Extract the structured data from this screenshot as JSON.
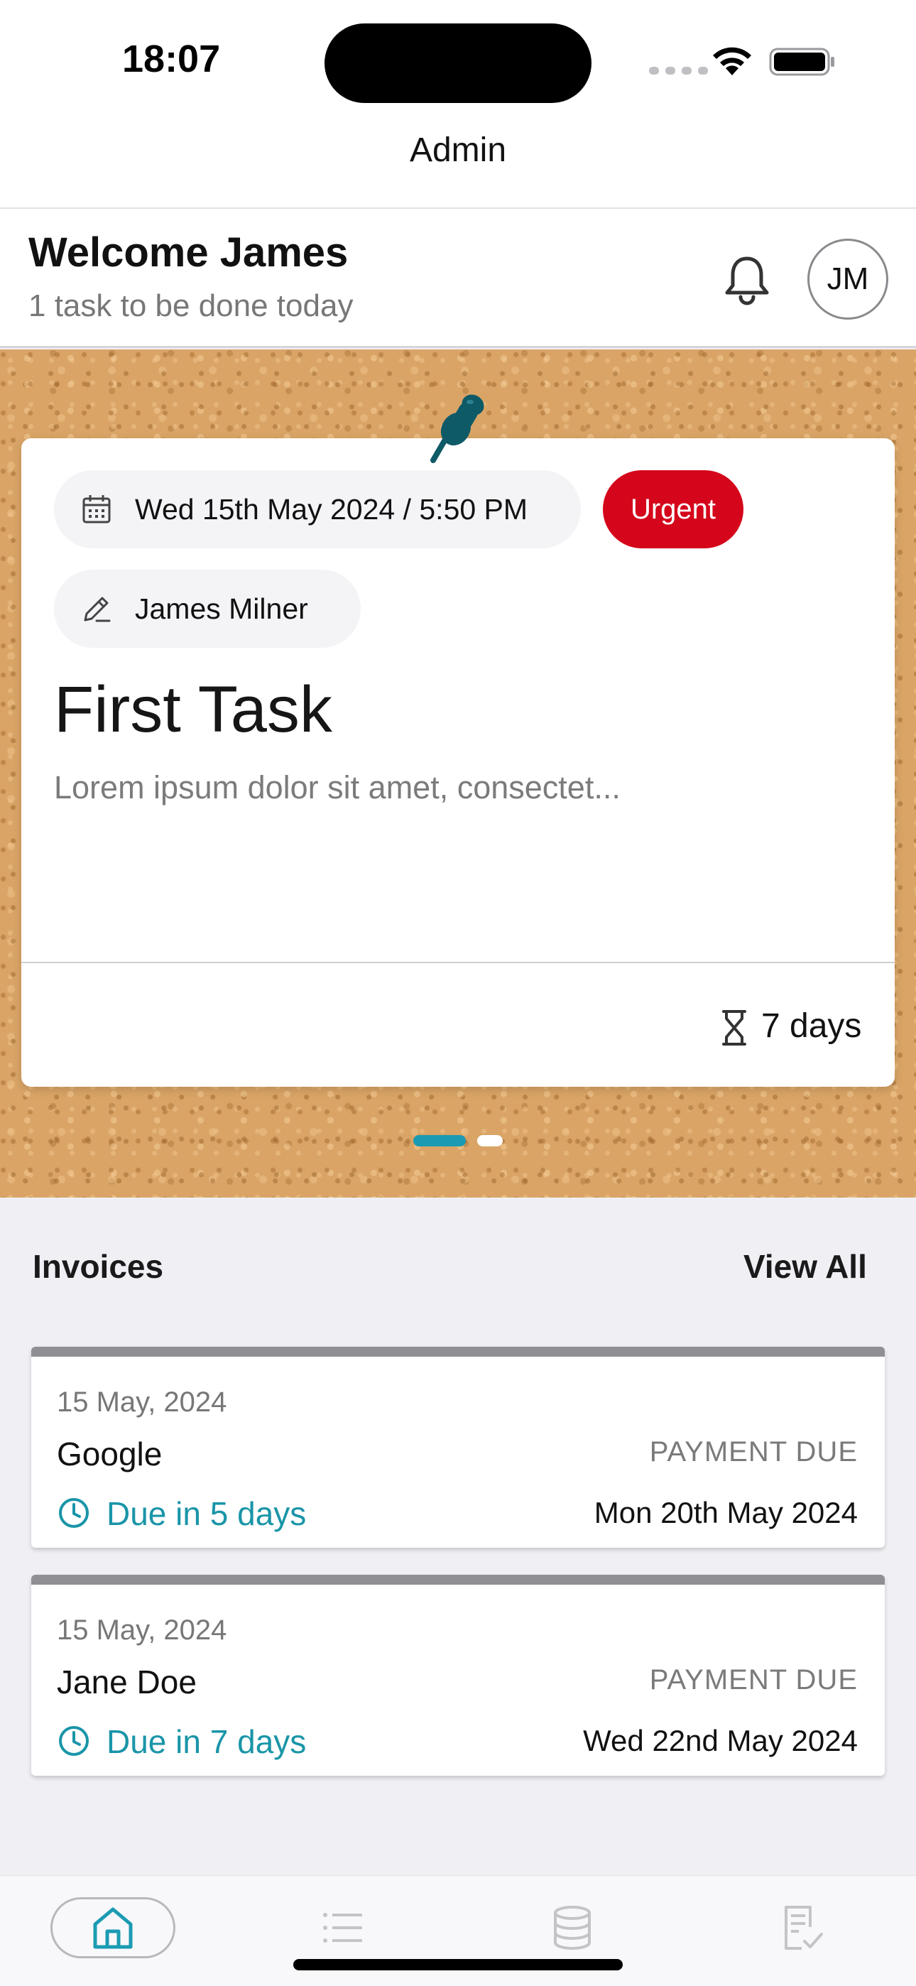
{
  "status_bar": {
    "time": "18:07"
  },
  "nav": {
    "title": "Admin"
  },
  "welcome": {
    "title": "Welcome James",
    "subtitle": "1 task to be done today",
    "avatar_initials": "JM"
  },
  "task": {
    "date": "Wed 15th May 2024 / 5:50 PM",
    "priority": "Urgent",
    "author": "James Milner",
    "title": "First Task",
    "description": "Lorem ipsum dolor sit amet, consectet...",
    "duration": "7 days",
    "page_current": 1,
    "page_count": 2
  },
  "invoices": {
    "title": "Invoices",
    "view_all": "View All",
    "items": [
      {
        "date": "15 May, 2024",
        "name": "Google",
        "status": "PAYMENT DUE",
        "due_text": "Due in 5 days",
        "due_date": "Mon 20th May 2024"
      },
      {
        "date": "15 May, 2024",
        "name": "Jane Doe",
        "status": "PAYMENT DUE",
        "due_text": "Due in 7 days",
        "due_date": "Wed 22nd May 2024"
      }
    ]
  },
  "tabs": [
    {
      "icon": "home-icon",
      "selected": true
    },
    {
      "icon": "list-icon",
      "selected": false
    },
    {
      "icon": "database-icon",
      "selected": false
    },
    {
      "icon": "task-check-icon",
      "selected": false
    }
  ],
  "colors": {
    "accent": "#1b9bb3",
    "urgent": "#d5061b",
    "due_text": "#1a95a8",
    "pin": "#0f5a67",
    "cork": "#d9a466"
  }
}
